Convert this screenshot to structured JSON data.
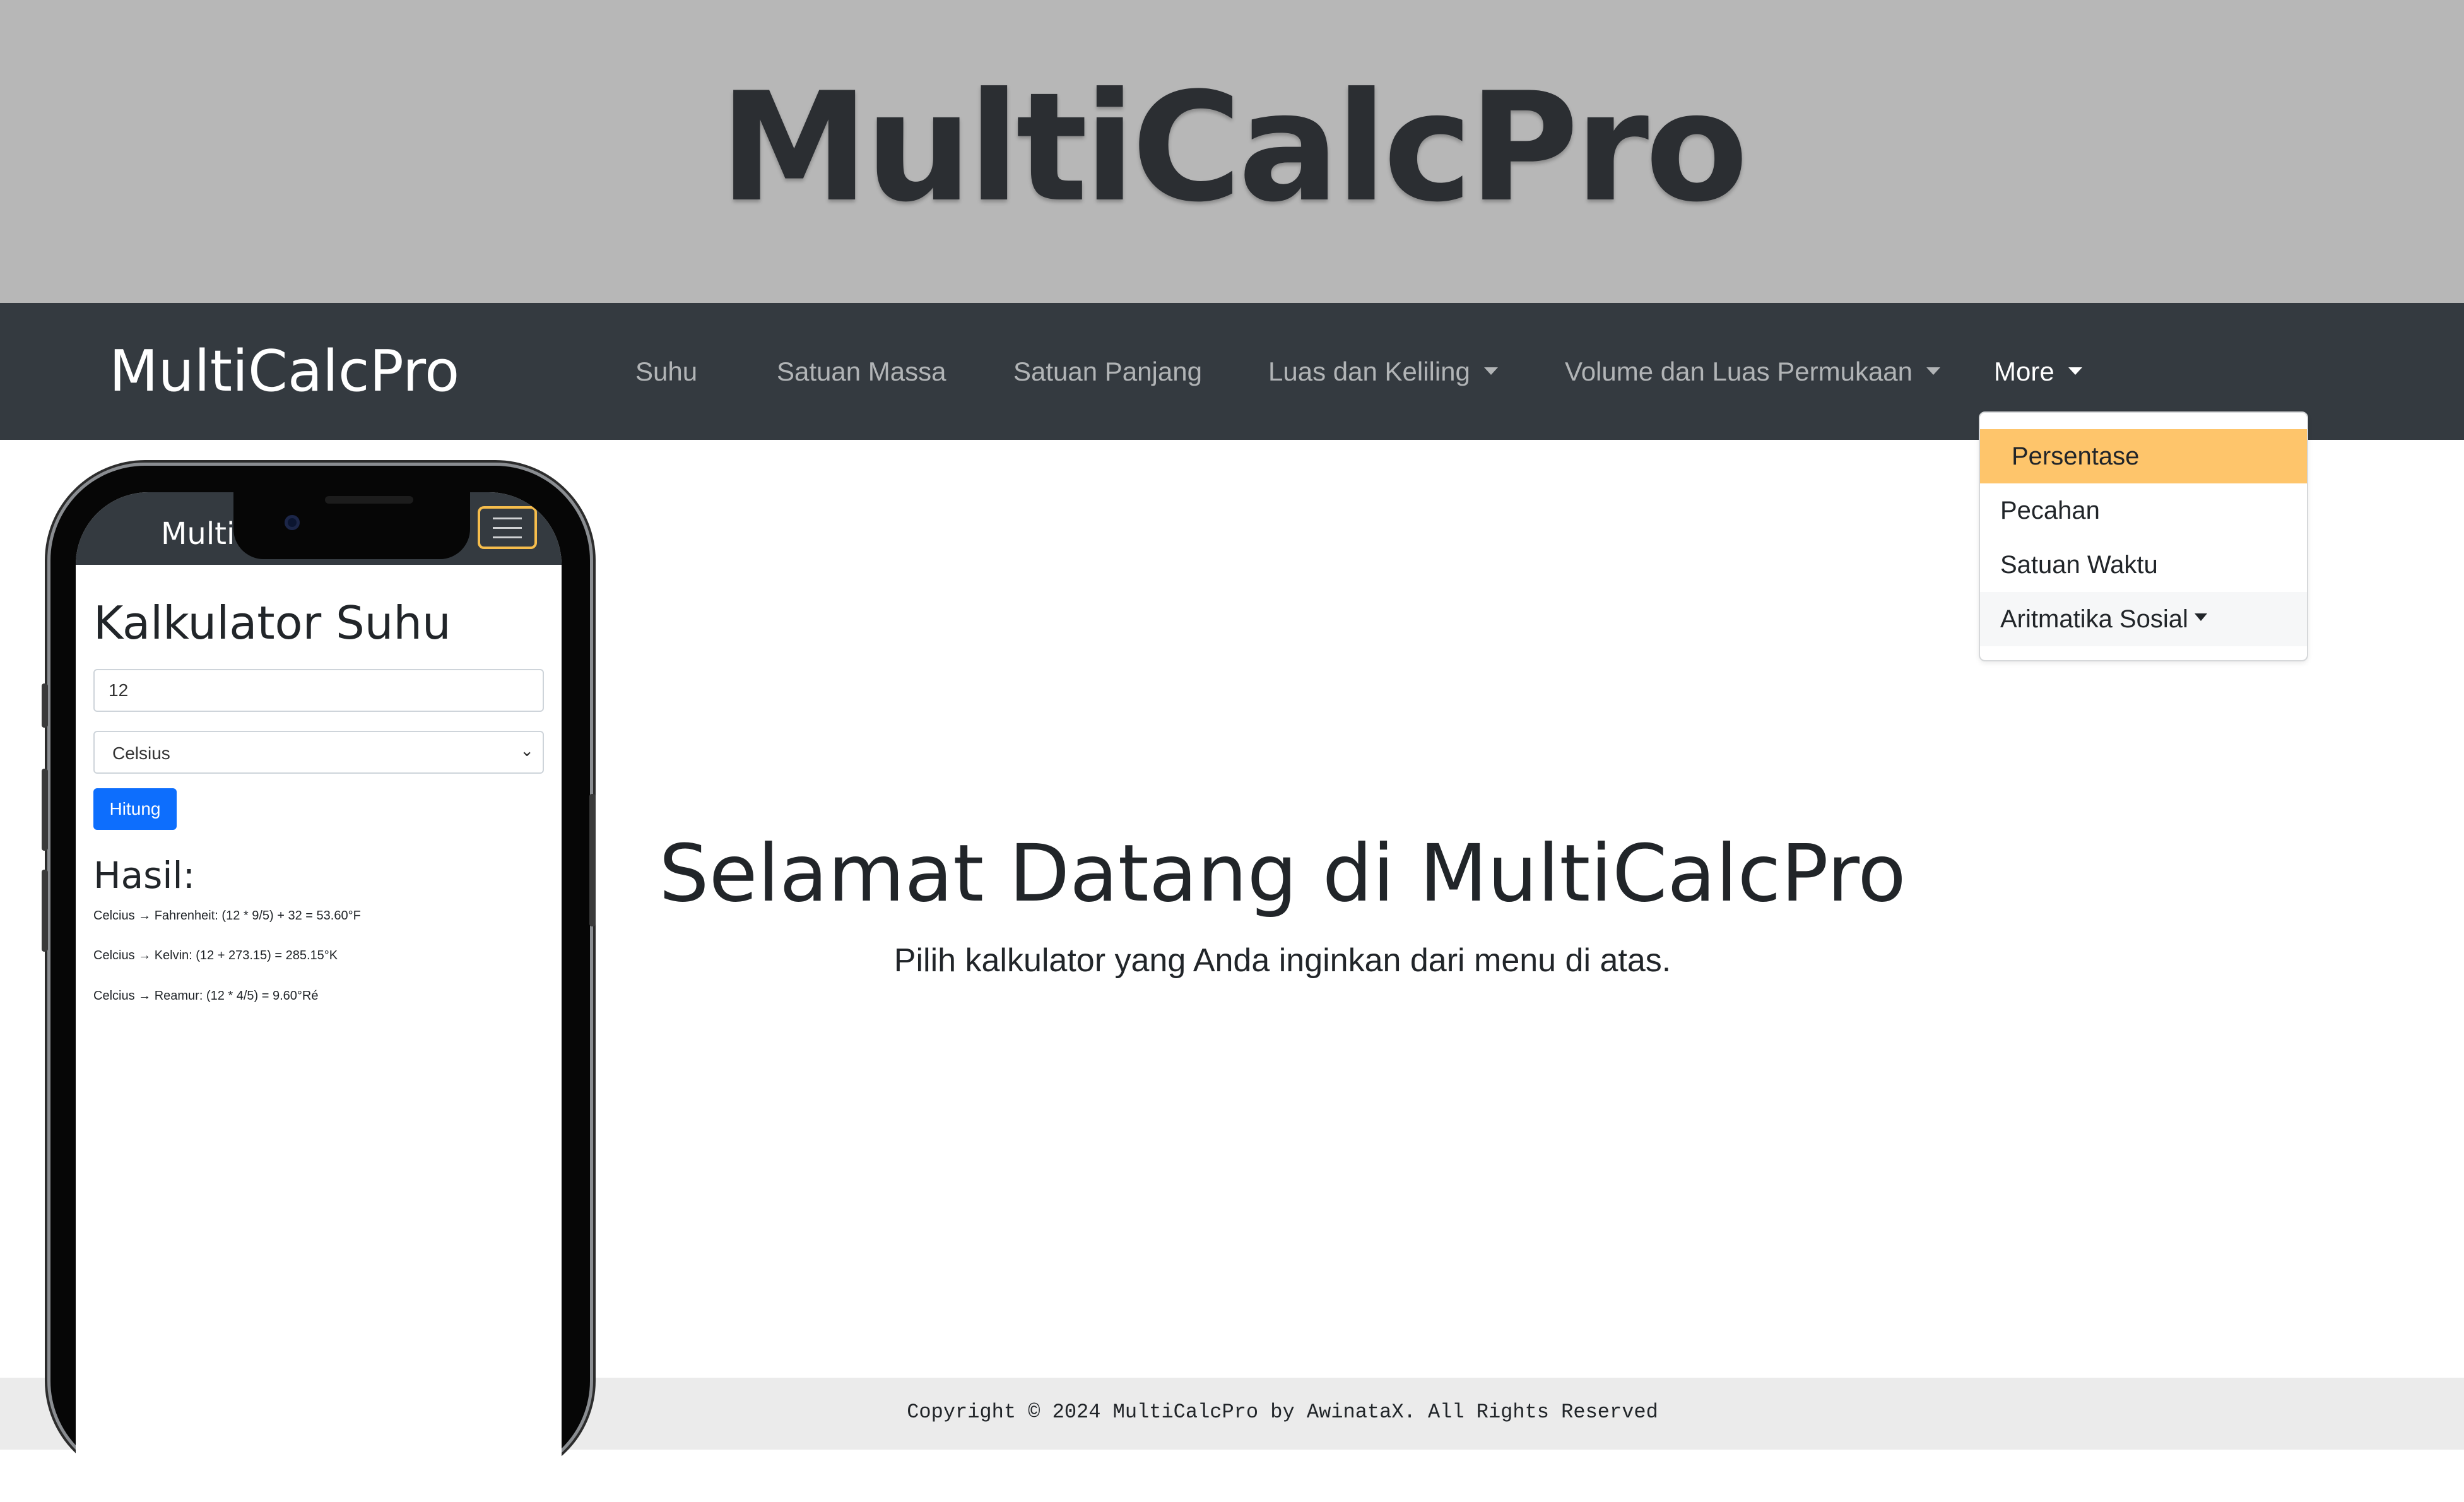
{
  "banner": {
    "title": "MultiCalcPro"
  },
  "navbar": {
    "brand": "MultiCalcPro",
    "items": [
      {
        "label": "Suhu"
      },
      {
        "label": "Satuan Massa"
      },
      {
        "label": "Satuan Panjang"
      },
      {
        "label": "Luas dan Keliling"
      },
      {
        "label": "Volume dan Luas Permukaan"
      },
      {
        "label": "More"
      }
    ]
  },
  "dropdown": {
    "items": [
      {
        "label": "Persentase"
      },
      {
        "label": "Pecahan"
      },
      {
        "label": "Satuan Waktu"
      },
      {
        "label": "Aritmatika Sosial"
      }
    ]
  },
  "hero": {
    "title": "Selamat Datang di MultiCalcPro",
    "subtitle": "Pilih kalkulator yang Anda inginkan dari menu di atas."
  },
  "phone": {
    "brand": "MultiCalcPro",
    "heading": "Kalkulator Suhu",
    "input_value": "12",
    "select_value": "Celsius",
    "button": "Hitung",
    "result_heading": "Hasil:",
    "results": [
      "Celcius → Fahrenheit: (12 * 9/5) + 32 = 53.60°F",
      "Celcius → Kelvin: (12 + 273.15) = 285.15°K",
      "Celcius → Reamur: (12 * 4/5) = 9.60°Ré"
    ]
  },
  "footer": {
    "text": "Copyright © 2024 MultiCalcPro by AwinataX. All Rights Reserved"
  },
  "colors": {
    "banner_bg": "#b7b7b7",
    "navbar_bg": "#343a40",
    "dropdown_highlight": "#fec56b",
    "primary_button": "#0d6efd",
    "footer_bg": "#ebebeb"
  }
}
